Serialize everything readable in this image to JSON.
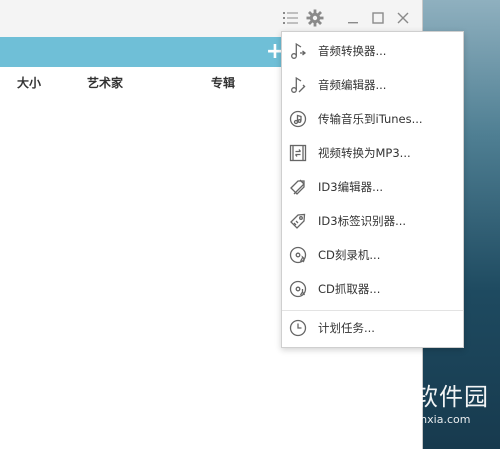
{
  "titlebar": {
    "icons": [
      "list-icon",
      "gear-icon",
      "minimize-icon",
      "maximize-icon",
      "close-icon"
    ]
  },
  "toolbar": {
    "add_label": "+"
  },
  "columns": {
    "size": "大小",
    "artist": "艺术家",
    "album": "专辑"
  },
  "menu": {
    "items": [
      {
        "label": "音频转换器...",
        "icon": "music-convert-icon"
      },
      {
        "label": "音频编辑器...",
        "icon": "music-edit-icon"
      },
      {
        "label": "传输音乐到iTunes...",
        "icon": "itunes-transfer-icon"
      },
      {
        "label": "视频转换为MP3...",
        "icon": "video-convert-icon"
      },
      {
        "label": "ID3编辑器...",
        "icon": "id3-edit-icon"
      },
      {
        "label": "ID3标签识别器...",
        "icon": "tag-icon"
      },
      {
        "label": "CD刻录机...",
        "icon": "cd-burn-icon"
      },
      {
        "label": "CD抓取器...",
        "icon": "cd-rip-icon"
      },
      {
        "label": "计划任务...",
        "icon": "clock-icon"
      }
    ]
  },
  "watermark": {
    "title": "当下软件园",
    "url": "www.downxia.com"
  },
  "colors": {
    "toolbar": "#6fbfd7",
    "icon": "#8a8a8a",
    "text": "#333333"
  }
}
